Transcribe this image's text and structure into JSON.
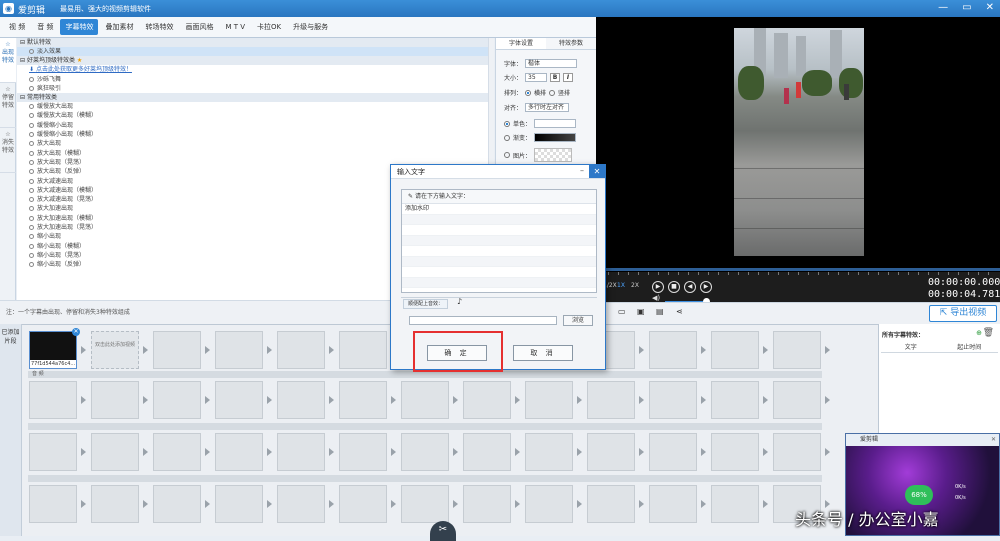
{
  "app": {
    "name": "爱剪辑",
    "slogan": "最易用、强大的视频剪辑软件",
    "window_controls": [
      "—",
      "▭",
      "✕"
    ]
  },
  "tabs": [
    {
      "label": "视 频",
      "active": false
    },
    {
      "label": "音 频",
      "active": false
    },
    {
      "label": "字幕特效",
      "active": true
    },
    {
      "label": "叠加素材",
      "active": false
    },
    {
      "label": "转场特效",
      "active": false
    },
    {
      "label": "画面风格",
      "active": false
    },
    {
      "label": "M T V",
      "active": false
    },
    {
      "label": "卡拉OK",
      "active": false
    },
    {
      "label": "升级与服务",
      "active": false
    }
  ],
  "sidebar": [
    {
      "label": "出现特效",
      "active": true
    },
    {
      "label": "停留特效",
      "active": false
    },
    {
      "label": "消失特效",
      "active": false
    }
  ],
  "effects": {
    "group_default": "默认特效",
    "default_item": "淡入效果",
    "group_good": "好莱坞顶级特效类",
    "good_link": "点击此处获取更多好莱坞顶级特效！",
    "good_items": [
      "沙砾飞舞",
      "疯狂吸引"
    ],
    "group_common": "常用特效类",
    "common_items": [
      "缓慢放大出现",
      "缓慢放大出现（模糊）",
      "缓慢缩小出现",
      "缓慢缩小出现（模糊）",
      "放大出现",
      "放大出现（模糊）",
      "放大出现（晃荡）",
      "放大出现（反弹）",
      "放大减速出现",
      "放大减速出现（模糊）",
      "放大减速出现（晃荡）",
      "放大加速出现",
      "放大加速出现（模糊）",
      "放大加速出现（晃荡）",
      "缩小出现",
      "缩小出现（模糊）",
      "缩小出现（晃荡）",
      "缩小出现（反弹）"
    ]
  },
  "font_settings": {
    "tab_font": "字体设置",
    "tab_effect": "特效参数",
    "font_label": "字体：",
    "font_value": "楷体",
    "size_label": "大小：",
    "size_value": "35",
    "bold": "B",
    "italic": "I",
    "layout_label": "排列：",
    "horizontal": "横排",
    "vertical": "竖排",
    "align_label": "对齐：",
    "align_value": "多行时左对齐",
    "single_color": "单色：",
    "gradient": "渐变：",
    "image": "图片："
  },
  "note": "注：一个字幕由出现、停留和消失3种特效组成",
  "player": {
    "speeds": [
      "1/2X",
      "1X",
      "2X"
    ],
    "current_time": "00:00:00.000",
    "total_time": "00:00:04.781",
    "export_label": "导出视频"
  },
  "timeline": {
    "side_label": "已添加片段",
    "clip_caption": "77f1d544a76c4...",
    "add_hint": "双击此处添加视频",
    "audio_label": "音 频"
  },
  "subtitle_panel": {
    "title": "所有字幕特效：",
    "col_text": "文字",
    "col_time": "起止时间"
  },
  "dialog": {
    "title": "输入文字",
    "prompt": "请在下方输入文字：",
    "text_value": "添加水印",
    "music_label": "顺便配上音效：",
    "browse": "浏览",
    "ok": "确 定",
    "cancel": "取 消"
  },
  "popup": {
    "title": "爱剪辑",
    "badge": "68%",
    "stat1": "0K/s",
    "stat2": "0K/s"
  },
  "watermark": "头条号 / 办公室小嘉"
}
